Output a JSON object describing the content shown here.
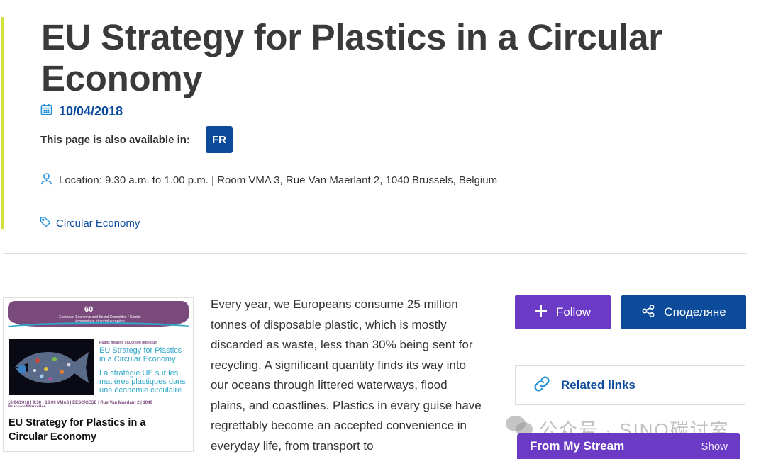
{
  "event": {
    "title": "EU Strategy for Plastics in a Circular Economy",
    "date": "10/04/2018",
    "available_label": "This page is also available in:",
    "languages": [
      "FR"
    ],
    "location": "Location:  9.30 a.m. to 1.00 p.m. | Room VMA 3, Rue Van Maerlant 2, 1040 Brussels, Belgium",
    "tag": "Circular Economy"
  },
  "card": {
    "title": "EU Strategy for Plastics in a Circular Economy",
    "poster": {
      "number": "60",
      "org_line": "European Economic and Social Committee / Comité économique et social européen",
      "hearing": "Public hearing / Audition publique",
      "title_en": "EU Strategy for Plastics in a Circular Economy",
      "title_fr": "La stratégie UE sur les matières plastiques dans une économie circulaire",
      "footer": "10/04/2018 | 9:30 - 13:00   VMA3 | EESC/CESE | Rue Van Maerlant 2 | 1040 Brussels/Bruxelles"
    }
  },
  "body_text": "Every year, we Europeans consume 25 million tonnes of disposable plastic, which is mostly discarded as waste, less than 30% being sent for recycling. A significant quantity finds its way into our oceans through littered waterways, flood plains, and coastlines. Plastics in every guise have regrettably become an accepted convenience in everyday life, from transport to",
  "sidebar": {
    "follow_label": "Follow",
    "share_label": "Споделяне",
    "related_label": "Related links",
    "stream_title": "From My Stream",
    "stream_action": "Show"
  },
  "watermark": "公众号 · SINO碳讨室",
  "colors": {
    "accent_bar": "#d5df3a",
    "brand_blue": "#0b4b9a",
    "purple": "#6b3bc6"
  }
}
